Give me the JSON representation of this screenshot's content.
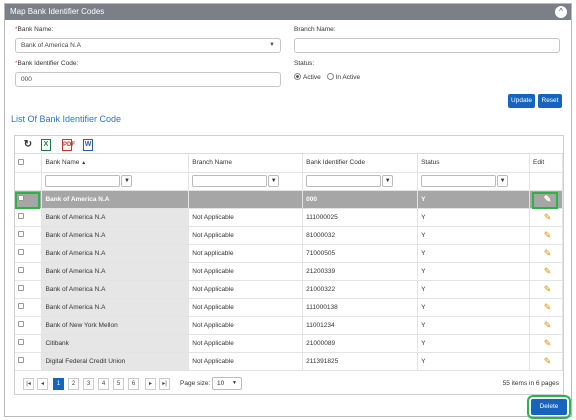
{
  "panel": {
    "title": "Map Bank Identifier Codes"
  },
  "form": {
    "bank_name_label": "Bank Name:",
    "bank_name_value": "Bank of America N.A",
    "branch_name_label": "Branch Name:",
    "branch_name_value": "",
    "code_label": "Bank Identifier Code:",
    "code_value": "000",
    "status_label": "Status:",
    "status_active": "Active",
    "status_inactive": "In Active",
    "status_selected": "Active",
    "required_mark": "*"
  },
  "buttons": {
    "update": "Update",
    "reset": "Reset",
    "delete": "Delete"
  },
  "list": {
    "title": "List Of Bank Identifier Code",
    "toolbar": {
      "excel": "X",
      "pdf": "PDF",
      "word": "W"
    },
    "columns": [
      "Bank Name",
      "Branch Name",
      "Bank Identifier Code",
      "Status",
      "Edit"
    ],
    "sort_indicator": "▲",
    "rows": [
      {
        "bank": "Bank of America N.A",
        "branch": "",
        "code": "000",
        "status": "Y",
        "selected": true
      },
      {
        "bank": "Bank of America N.A",
        "branch": "Not Applicable",
        "code": "111000025",
        "status": "Y"
      },
      {
        "bank": "Bank of America N.A",
        "branch": "Not Applicable",
        "code": "81000032",
        "status": "Y"
      },
      {
        "bank": "Bank of America N.A",
        "branch": "Not applicable",
        "code": "71000505",
        "status": "Y"
      },
      {
        "bank": "Bank of America N.A",
        "branch": "Not Applicable",
        "code": "21200339",
        "status": "Y"
      },
      {
        "bank": "Bank of America N.A",
        "branch": "Not Applicable",
        "code": "21000322",
        "status": "Y"
      },
      {
        "bank": "Bank of America N.A",
        "branch": "Not Applicable",
        "code": "111000138",
        "status": "Y"
      },
      {
        "bank": "Bank of New York Mellon",
        "branch": "Not Applicable",
        "code": "11001234",
        "status": "Y"
      },
      {
        "bank": "Citibank",
        "branch": "Not Applicable",
        "code": "21000089",
        "status": "Y"
      },
      {
        "bank": "Digital Federal Credit Union",
        "branch": "Not Applicable",
        "code": "211391825",
        "status": "Y"
      }
    ],
    "pager": {
      "pages": [
        "1",
        "2",
        "3",
        "4",
        "5",
        "6"
      ],
      "current": "1",
      "page_size_label": "Page size:",
      "page_size": "10",
      "info": "55 items in 6 pages"
    }
  },
  "colors": {
    "accent": "#1565c0",
    "header": "#7a7f88",
    "highlight": "#2bb34a",
    "edit_icon": "#e08a00"
  }
}
